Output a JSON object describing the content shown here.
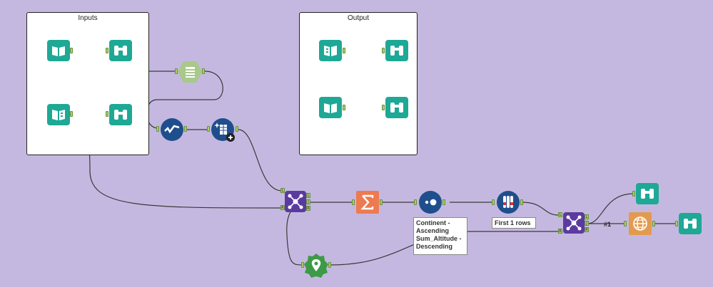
{
  "canvas": {
    "background": "#c5b8e0"
  },
  "containers": {
    "inputs": {
      "title": "Inputs"
    },
    "output": {
      "title": "Output"
    }
  },
  "annotations": {
    "sort": "Continent -\nAscending\nSum_Altitude -\nDescending",
    "sample": "First 1 rows"
  },
  "connection_labels": {
    "join_to_report": "#1"
  },
  "colors": {
    "teal": "#1ea896",
    "navy": "#1f4e8c",
    "purple": "#5b3aa0",
    "orange": "#ee7a50",
    "green": "#3d9a46",
    "light_green": "#a8c98a",
    "report_orange": "#e39a4e",
    "anchor": "#a6d06a",
    "wire": "#3a3a3a"
  },
  "tools": [
    {
      "id": "input-1",
      "icon": "book-open-icon",
      "color": "#1ea896"
    },
    {
      "id": "browse-1",
      "icon": "binoculars-icon",
      "color": "#1ea896"
    },
    {
      "id": "input-2",
      "icon": "book-list-icon",
      "color": "#1ea896"
    },
    {
      "id": "browse-2",
      "icon": "binoculars-icon",
      "color": "#1ea896"
    },
    {
      "id": "filter",
      "icon": "filter-table-icon",
      "color": "#a8c98a"
    },
    {
      "id": "select",
      "icon": "checkmark-flow-icon",
      "color": "#1f4e8c"
    },
    {
      "id": "formula",
      "icon": "sparkle-table-icon",
      "color": "#1f4e8c"
    },
    {
      "id": "join-1",
      "icon": "join-network-icon",
      "color": "#5b3aa0"
    },
    {
      "id": "summarize",
      "icon": "sigma-icon",
      "color": "#ee7a50"
    },
    {
      "id": "sort",
      "icon": "sort-dots-icon",
      "color": "#1f4e8c"
    },
    {
      "id": "sample",
      "icon": "test-tubes-icon",
      "color": "#1f4e8c"
    },
    {
      "id": "spatial",
      "icon": "map-pin-icon",
      "color": "#3d9a46"
    },
    {
      "id": "join-2",
      "icon": "join-network-icon",
      "color": "#5b3aa0"
    },
    {
      "id": "browse-3",
      "icon": "binoculars-icon",
      "color": "#1ea896"
    },
    {
      "id": "report",
      "icon": "globe-report-icon",
      "color": "#e39a4e"
    },
    {
      "id": "browse-4",
      "icon": "binoculars-icon",
      "color": "#1ea896"
    },
    {
      "id": "output-1",
      "icon": "book-list-icon",
      "color": "#1ea896"
    },
    {
      "id": "browse-5",
      "icon": "binoculars-icon",
      "color": "#1ea896"
    },
    {
      "id": "output-2",
      "icon": "book-open-icon",
      "color": "#1ea896"
    },
    {
      "id": "browse-6",
      "icon": "binoculars-icon",
      "color": "#1ea896"
    }
  ]
}
